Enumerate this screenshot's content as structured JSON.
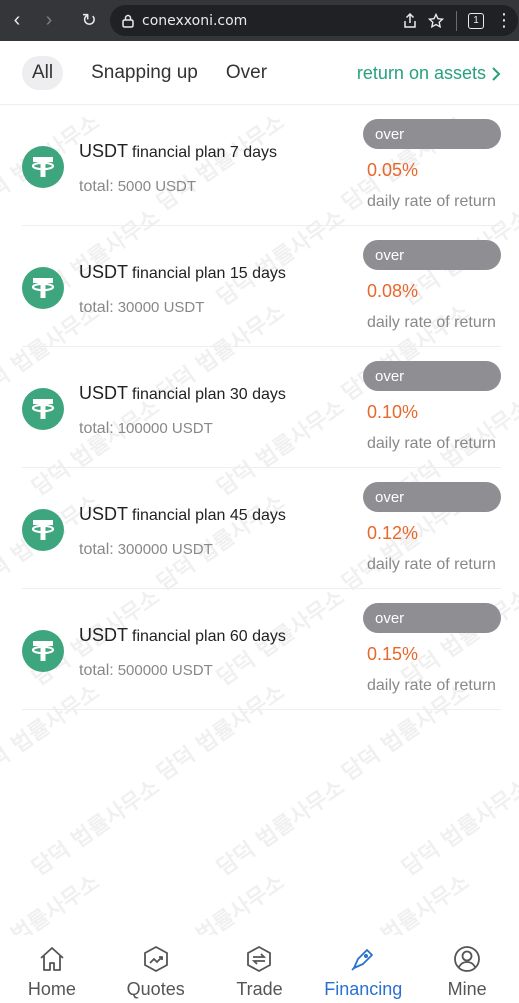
{
  "browser": {
    "url": "conexxoni.com",
    "tab_count": "1"
  },
  "filters": {
    "all": "All",
    "snapping_up": "Snapping up",
    "over": "Over",
    "return_on_assets": "return on assets"
  },
  "plans": [
    {
      "coin": "USDT",
      "name": "financial plan 7 days",
      "total_label": "total:",
      "total_value": "5000 USDT",
      "status": "over",
      "rate": "0.05%",
      "rate_label": "daily rate of return"
    },
    {
      "coin": "USDT",
      "name": "financial plan 15 days",
      "total_label": "total:",
      "total_value": "30000 USDT",
      "status": "over",
      "rate": "0.08%",
      "rate_label": "daily rate of return"
    },
    {
      "coin": "USDT",
      "name": "financial plan 30 days",
      "total_label": "total:",
      "total_value": "100000 USDT",
      "status": "over",
      "rate": "0.10%",
      "rate_label": "daily rate of return"
    },
    {
      "coin": "USDT",
      "name": "financial plan 45 days",
      "total_label": "total:",
      "total_value": "300000 USDT",
      "status": "over",
      "rate": "0.12%",
      "rate_label": "daily rate of return"
    },
    {
      "coin": "USDT",
      "name": "financial plan 60 days",
      "total_label": "total:",
      "total_value": "500000 USDT",
      "status": "over",
      "rate": "0.15%",
      "rate_label": "daily rate of return"
    }
  ],
  "watermark_text": "담덕 법률사무소",
  "nav": {
    "home": "Home",
    "quotes": "Quotes",
    "trade": "Trade",
    "financing": "Financing",
    "mine": "Mine"
  },
  "colors": {
    "accent_green": "#27a17c",
    "tether_green": "#3ea67f",
    "rate_orange": "#e8672b",
    "badge_gray": "#8e8e93",
    "nav_active_blue": "#2a71d0"
  }
}
